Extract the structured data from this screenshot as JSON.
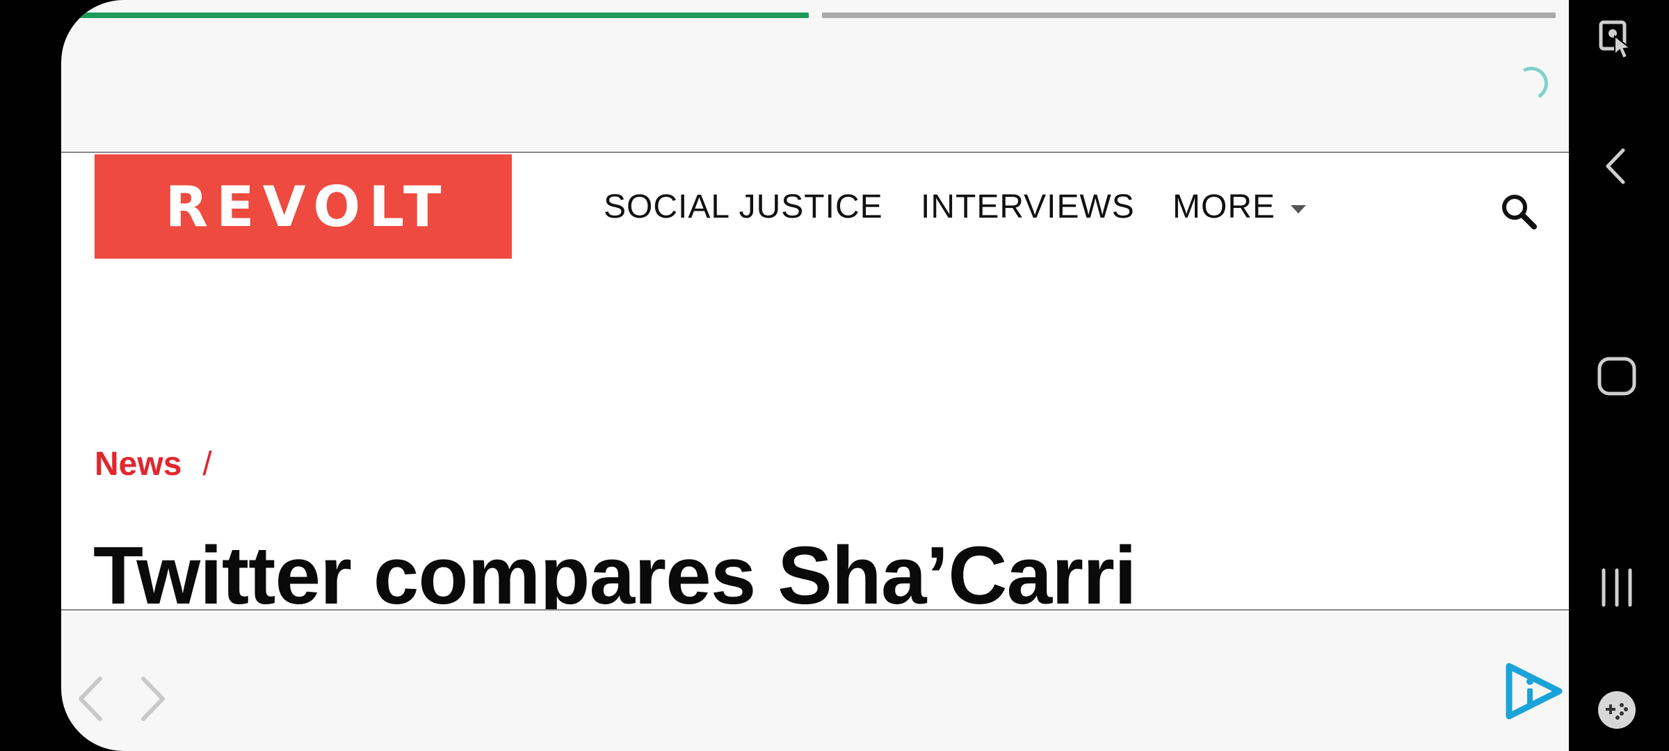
{
  "story_progress": [
    {
      "label": "story-1",
      "fraction_filled": 1.0
    },
    {
      "label": "story-2",
      "fraction_filled": 0.0
    }
  ],
  "header": {
    "logo_text": "REVOLT",
    "nav": {
      "social_justice": "SOCIAL JUSTICE",
      "interviews": "INTERVIEWS",
      "more": "MORE"
    }
  },
  "article": {
    "breadcrumb": "News",
    "breadcrumb_separator": "/",
    "headline": "Twitter compares Sha’Carri"
  },
  "icons": {
    "search": "search-icon",
    "loading": "loading-spinner-icon",
    "back": "chevron-left-icon",
    "forward": "chevron-right-icon",
    "brand": "play-info-icon",
    "system": [
      "screenshot-touch-icon",
      "back-icon",
      "home-icon",
      "recents-icon",
      "game-tools-icon"
    ]
  },
  "colors": {
    "brand_red": "#ef4a3f",
    "breadcrumb_red": "#e2262d",
    "progress_green": "#1e9b5a",
    "spinner_teal": "#7fd1cb",
    "brand_blue": "#1aa3d8"
  }
}
